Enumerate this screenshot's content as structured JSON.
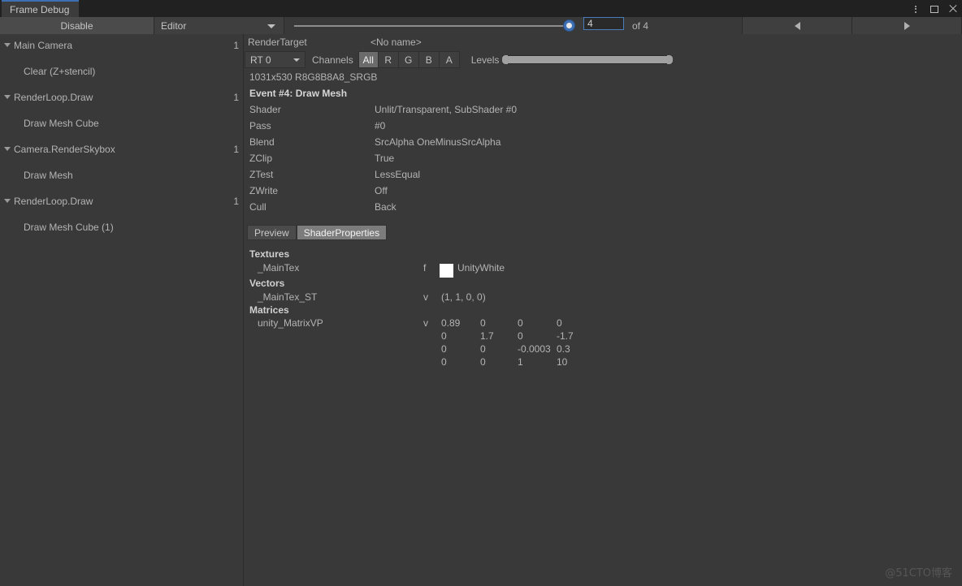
{
  "window": {
    "tab_title": "Frame Debug",
    "controls": {
      "menu": "kebab-menu-icon",
      "maximize": "maximize-icon",
      "close": "close-icon"
    }
  },
  "toolbar": {
    "disable_label": "Disable",
    "target_dropdown": "Editor",
    "event_index_value": "4",
    "event_total_label": "of 4",
    "prev_icon": "triangle-left-icon",
    "next_icon": "triangle-right-icon"
  },
  "tree": {
    "items": [
      {
        "label": "Main Camera",
        "count": "1",
        "level": 0,
        "foldout": true
      },
      {
        "label": "Clear (Z+stencil)",
        "count": "",
        "level": 1,
        "foldout": false
      },
      {
        "label": "RenderLoop.Draw",
        "count": "1",
        "level": 0,
        "foldout": true
      },
      {
        "label": "Draw Mesh Cube",
        "count": "",
        "level": 1,
        "foldout": false
      },
      {
        "label": "Camera.RenderSkybox",
        "count": "1",
        "level": 0,
        "foldout": true
      },
      {
        "label": "Draw Mesh",
        "count": "",
        "level": 1,
        "foldout": false
      },
      {
        "label": "RenderLoop.Draw",
        "count": "1",
        "level": 0,
        "foldout": true
      },
      {
        "label": "Draw Mesh Cube (1)",
        "count": "",
        "level": 1,
        "foldout": false
      }
    ]
  },
  "render_target": {
    "header_label": "RenderTarget",
    "name_value": "<No name>",
    "rt_select": "RT 0",
    "channels_label": "Channels",
    "channels": [
      "All",
      "R",
      "G",
      "B",
      "A"
    ],
    "channel_active": "All",
    "levels_label": "Levels",
    "info": "1031x530 R8G8B8A8_SRGB"
  },
  "event": {
    "title": "Event #4: Draw Mesh",
    "properties": [
      {
        "key": "Shader",
        "value": "Unlit/Transparent, SubShader #0"
      },
      {
        "key": "Pass",
        "value": "#0"
      },
      {
        "key": "Blend",
        "value": "SrcAlpha OneMinusSrcAlpha"
      },
      {
        "key": "ZClip",
        "value": "True"
      },
      {
        "key": "ZTest",
        "value": "LessEqual"
      },
      {
        "key": "ZWrite",
        "value": "Off"
      },
      {
        "key": "Cull",
        "value": "Back"
      }
    ]
  },
  "tabs": {
    "items": [
      "Preview",
      "ShaderProperties"
    ],
    "active": "ShaderProperties"
  },
  "shader_properties": {
    "textures_header": "Textures",
    "textures": [
      {
        "name": "_MainTex",
        "flag": "f",
        "swatch_color": "#ffffff",
        "value": "UnityWhite"
      }
    ],
    "vectors_header": "Vectors",
    "vectors": [
      {
        "name": "_MainTex_ST",
        "flag": "v",
        "value": "(1, 1, 0, 0)"
      }
    ],
    "matrices_header": "Matrices",
    "matrices": [
      {
        "name": "unity_MatrixVP",
        "flag": "v",
        "rows": [
          [
            "0.89",
            "0",
            "0",
            "0"
          ],
          [
            "0",
            "1.7",
            "0",
            "-1.7"
          ],
          [
            "0",
            "0",
            "-0.0003",
            "0.3"
          ],
          [
            "0",
            "0",
            "1",
            "10"
          ]
        ]
      }
    ]
  },
  "watermark": "@51CTO博客",
  "colors": {
    "panel_bg": "#393939",
    "titlebar_bg": "#212121",
    "accent_blue": "#4a7ebb",
    "button_bg": "#4b4b4b",
    "active_tab_bg": "#7c7c7c"
  }
}
